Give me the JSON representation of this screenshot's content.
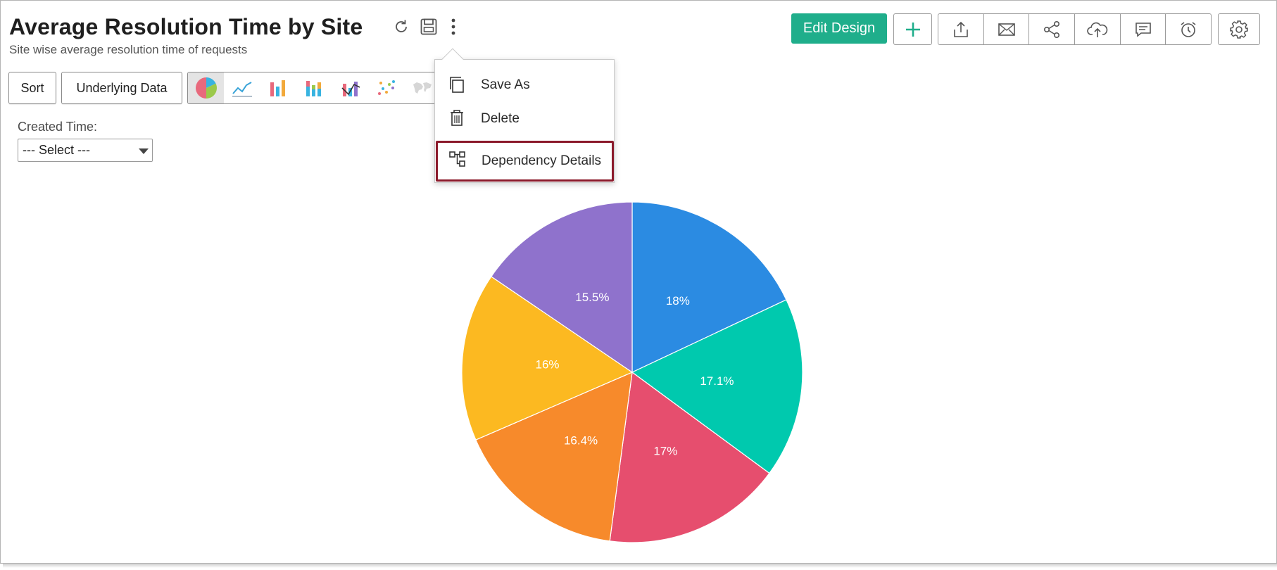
{
  "header": {
    "title": "Average Resolution Time by Site",
    "subtitle": "Site wise average resolution time of requests"
  },
  "toolbar": {
    "edit_design_label": "Edit Design",
    "icons": [
      "refresh-icon",
      "save-icon",
      "more-vertical-icon",
      "add-icon",
      "export-icon",
      "email-icon",
      "share-icon",
      "publish-icon",
      "comment-icon",
      "alarm-icon",
      "settings-icon"
    ]
  },
  "actions": {
    "sort_label": "Sort",
    "underlying_data_label": "Underlying Data",
    "chart_types": [
      "pie-chart-icon",
      "line-chart-icon",
      "bar-chart-icon",
      "stacked-bar-chart-icon",
      "combination-chart-icon",
      "scatter-chart-icon",
      "map-chart-icon"
    ]
  },
  "filter": {
    "label": "Created Time:",
    "selected": "--- Select ---"
  },
  "menu": {
    "items": [
      {
        "label": "Save As",
        "icon": "copy-icon"
      },
      {
        "label": "Delete",
        "icon": "trash-icon"
      },
      {
        "label": "Dependency Details",
        "icon": "dependency-icon"
      }
    ]
  },
  "colors": {
    "accent": "#1fae8b",
    "highlight_border": "#8b1a2b"
  },
  "chart_data": {
    "type": "pie",
    "slices": [
      {
        "label": "18%",
        "value": 18,
        "color": "#2b8be2"
      },
      {
        "label": "17.1%",
        "value": 17.1,
        "color": "#00c9ae"
      },
      {
        "label": "17%",
        "value": 17,
        "color": "#e64e6e"
      },
      {
        "label": "16.4%",
        "value": 16.4,
        "color": "#f78a2b"
      },
      {
        "label": "16%",
        "value": 16,
        "color": "#fcb921"
      },
      {
        "label": "15.5%",
        "value": 15.5,
        "color": "#8f72cc"
      }
    ]
  }
}
